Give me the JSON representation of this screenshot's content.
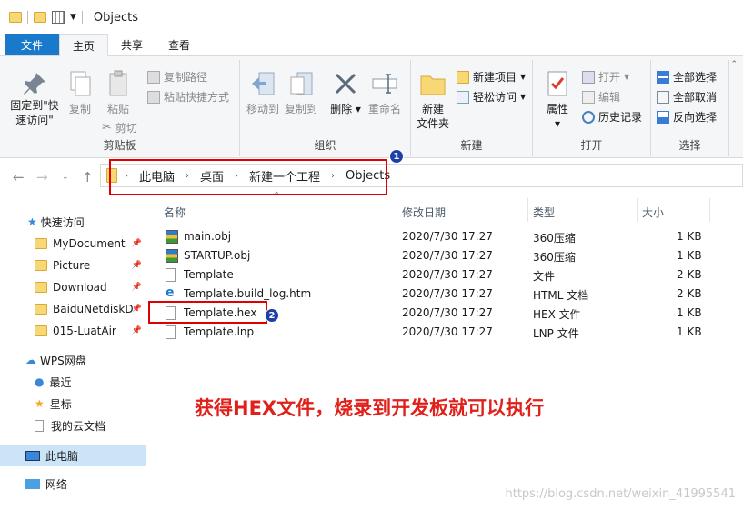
{
  "window": {
    "title": "Objects"
  },
  "tabs": {
    "file": "文件",
    "home": "主页",
    "share": "共享",
    "view": "查看"
  },
  "ribbon": {
    "clipboard": {
      "label": "剪贴板",
      "pin": "固定到\"快\n速访问\"",
      "copy": "复制",
      "paste": "粘贴",
      "copy_path": "复制路径",
      "paste_shortcut": "粘贴快捷方式",
      "cut": "剪切"
    },
    "organize": {
      "label": "组织",
      "move_to": "移动到",
      "copy_to": "复制到",
      "delete": "删除",
      "rename": "重命名"
    },
    "new": {
      "label": "新建",
      "new_folder": "新建\n文件夹",
      "new_item": "新建项目",
      "easy_access": "轻松访问"
    },
    "open": {
      "label": "打开",
      "properties": "属性",
      "open": "打开",
      "edit": "编辑",
      "history": "历史记录"
    },
    "select": {
      "label": "选择",
      "select_all": "全部选择",
      "select_none": "全部取消",
      "invert": "反向选择"
    }
  },
  "address": {
    "crumbs": [
      "此电脑",
      "桌面",
      "新建一个工程",
      "Objects"
    ]
  },
  "sidebar": {
    "quick_access": "快速访问",
    "items": [
      "MyDocument",
      "Picture",
      "Download",
      "BaiduNetdiskD",
      "015-LuatAir"
    ],
    "wps": "WPS网盘",
    "recent": "最近",
    "starred": "星标",
    "cloud_docs": "我的云文档",
    "this_pc": "此电脑",
    "network": "网络"
  },
  "columns": {
    "name": "名称",
    "modified": "修改日期",
    "type": "类型",
    "size": "大小"
  },
  "files": [
    {
      "name": "main.obj",
      "date": "2020/7/30 17:27",
      "type": "360压缩",
      "size": "1 KB",
      "icon": "archive-icon"
    },
    {
      "name": "STARTUP.obj",
      "date": "2020/7/30 17:27",
      "type": "360压缩",
      "size": "1 KB",
      "icon": "archive-icon"
    },
    {
      "name": "Template",
      "date": "2020/7/30 17:27",
      "type": "文件",
      "size": "2 KB",
      "icon": "file-icon"
    },
    {
      "name": "Template.build_log.htm",
      "date": "2020/7/30 17:27",
      "type": "HTML 文档",
      "size": "2 KB",
      "icon": "ie-icon"
    },
    {
      "name": "Template.hex",
      "date": "2020/7/30 17:27",
      "type": "HEX 文件",
      "size": "1 KB",
      "icon": "file-icon"
    },
    {
      "name": "Template.lnp",
      "date": "2020/7/30 17:27",
      "type": "LNP 文件",
      "size": "1 KB",
      "icon": "file-icon"
    }
  ],
  "badges": [
    "1",
    "2"
  ],
  "annotation": "获得HEX文件，烧录到开发板就可以执行",
  "watermark": "https://blog.csdn.net/weixin_41995541",
  "colors": {
    "accent": "#1979ca",
    "highlight": "#e00000",
    "badge": "#1f3ea8"
  }
}
